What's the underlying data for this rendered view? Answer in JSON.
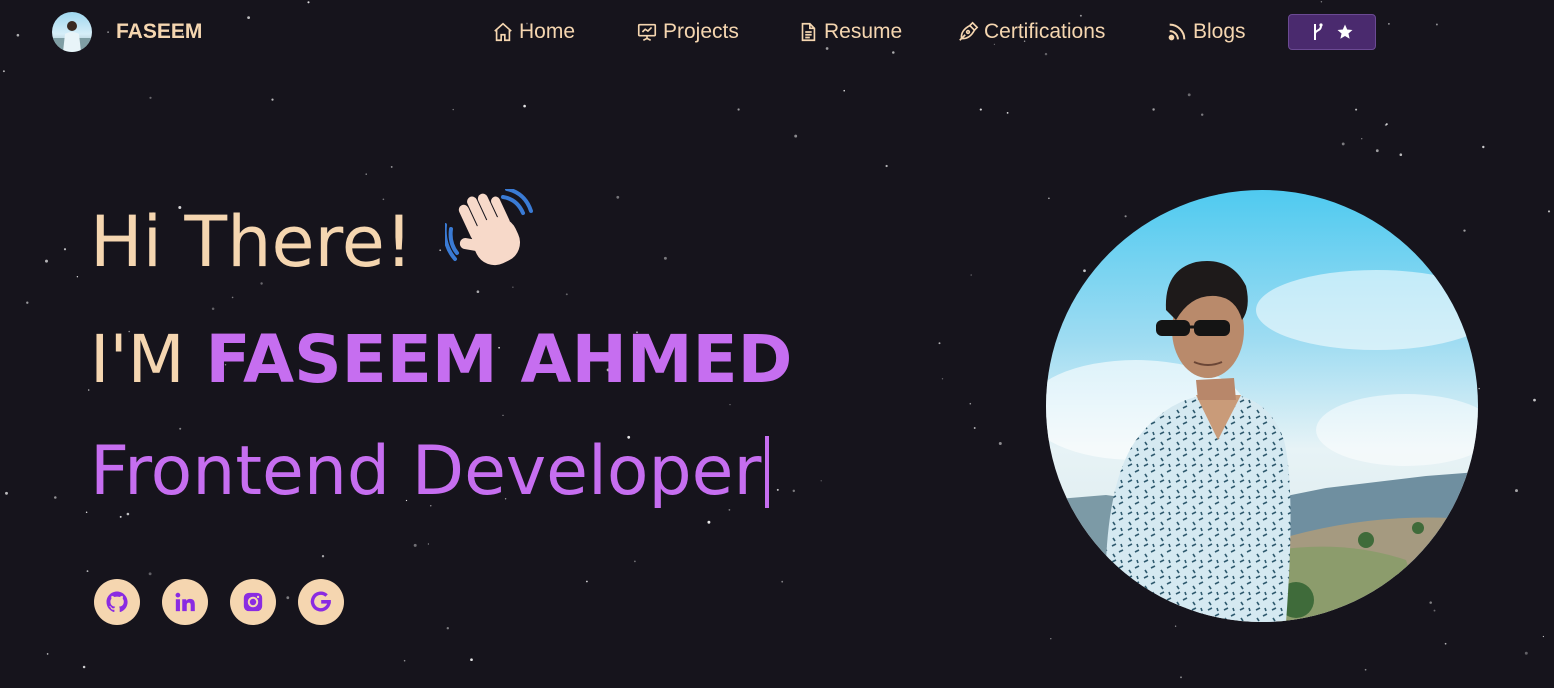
{
  "brand": {
    "name": "FASEEM",
    "avatar_icon": "profile-photo"
  },
  "nav": {
    "items": [
      {
        "label": "Home",
        "icon": "home-icon"
      },
      {
        "label": "Projects",
        "icon": "presentation-icon"
      },
      {
        "label": "Resume",
        "icon": "document-icon"
      },
      {
        "label": "Certifications",
        "icon": "pen-nib-icon"
      },
      {
        "label": "Blogs",
        "icon": "rss-icon"
      }
    ],
    "fork_button": {
      "icons": [
        "git-fork-icon",
        "star-icon"
      ]
    }
  },
  "hero": {
    "greeting": "Hi There!",
    "greeting_emoji": "waving-hand",
    "intro_prefix": "I'M ",
    "name": "FASEEM AHMED",
    "role": "Frontend Developer"
  },
  "social": [
    {
      "icon": "github-icon"
    },
    {
      "icon": "linkedin-icon"
    },
    {
      "icon": "instagram-icon"
    },
    {
      "icon": "google-icon"
    }
  ],
  "colors": {
    "background": "#16141c",
    "text_peach": "#f5d6b0",
    "accent_purple": "#c66ef0",
    "fork_button_bg": "#4a2a6e"
  }
}
